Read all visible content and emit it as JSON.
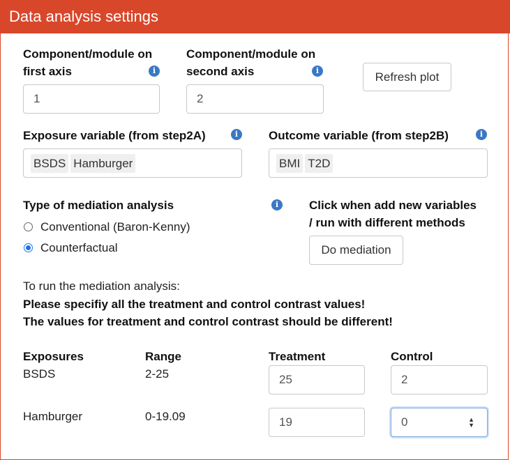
{
  "header": {
    "title": "Data analysis settings"
  },
  "axes": {
    "first_label": "Component/module on first axis",
    "first_value": "1",
    "second_label": "Component/module on second axis",
    "second_value": "2",
    "refresh_label": "Refresh plot"
  },
  "exposure": {
    "label": "Exposure variable (from step2A)",
    "tags": [
      "BSDS",
      "Hamburger"
    ]
  },
  "outcome": {
    "label": "Outcome variable (from step2B)",
    "tags": [
      "BMI",
      "T2D"
    ]
  },
  "mediation_type": {
    "label": "Type of mediation analysis",
    "options": [
      "Conventional (Baron-Kenny)",
      "Counterfactual"
    ],
    "selected": "Counterfactual"
  },
  "do_mediation": {
    "label_line1": "Click when add new variables",
    "label_line2": "/ run with different methods",
    "button_label": "Do mediation"
  },
  "instructions": {
    "line1": "To run the mediation analysis:",
    "line2": "Please specifiy all the treatment and control contrast values!",
    "line3": "The values for treatment and control contrast should be different!"
  },
  "contrast_table": {
    "headers": [
      "Exposures",
      "Range",
      "Treatment",
      "Control"
    ],
    "rows": [
      {
        "exposure": "BSDS",
        "range": "2-25",
        "treatment": "25",
        "control": "2"
      },
      {
        "exposure": "Hamburger",
        "range": "0-19.09",
        "treatment": "19",
        "control": "0"
      }
    ]
  },
  "icons": {
    "info": "info-icon",
    "spinner": "spinner-arrows-icon"
  },
  "colors": {
    "header_bg": "#d9472b",
    "info_blue": "#3b78c4",
    "radio_blue": "#1a73e8"
  }
}
